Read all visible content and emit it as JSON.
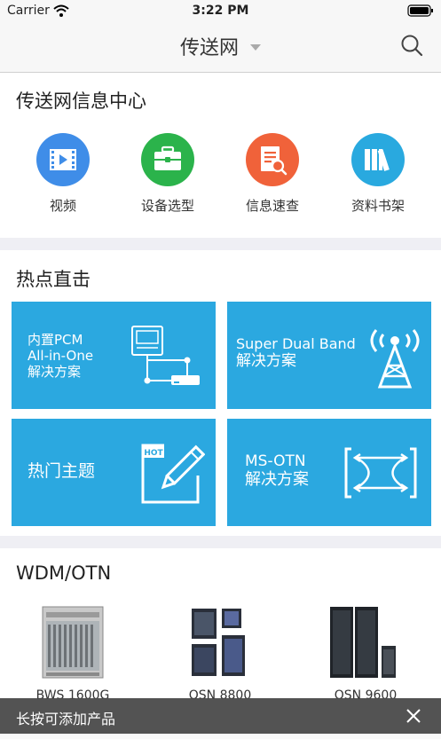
{
  "status": {
    "carrier": "Carrier",
    "time": "3:22 PM"
  },
  "nav": {
    "title": "传送网"
  },
  "info_center": {
    "title": "传送网信息中心",
    "items": [
      {
        "label": "视频",
        "icon": "video-icon",
        "color": "#3f8de8"
      },
      {
        "label": "设备选型",
        "icon": "briefcase-icon",
        "color": "#2bb34b"
      },
      {
        "label": "信息速查",
        "icon": "document-search-icon",
        "color": "#f0623a"
      },
      {
        "label": "资料书架",
        "icon": "bookshelf-icon",
        "color": "#29a9df"
      }
    ]
  },
  "hot": {
    "title": "热点直击",
    "tiles": [
      {
        "lines": [
          "内置PCM",
          "All-in-One",
          "解决方案"
        ]
      },
      {
        "lines": [
          "Super Dual Band",
          "解决方案"
        ]
      },
      {
        "lines": [
          "热门主题"
        ],
        "badge": "HOT"
      },
      {
        "lines": [
          "MS-OTN",
          "解决方案"
        ]
      }
    ]
  },
  "wdm": {
    "title": "WDM/OTN",
    "products": [
      {
        "label": "BWS 1600G"
      },
      {
        "label": "OSN 8800"
      },
      {
        "label": "OSN 9600"
      }
    ]
  },
  "toast": {
    "message": "长按可添加产品"
  },
  "colors": {
    "tile": "#2ba8e0",
    "toast": "#464646"
  }
}
